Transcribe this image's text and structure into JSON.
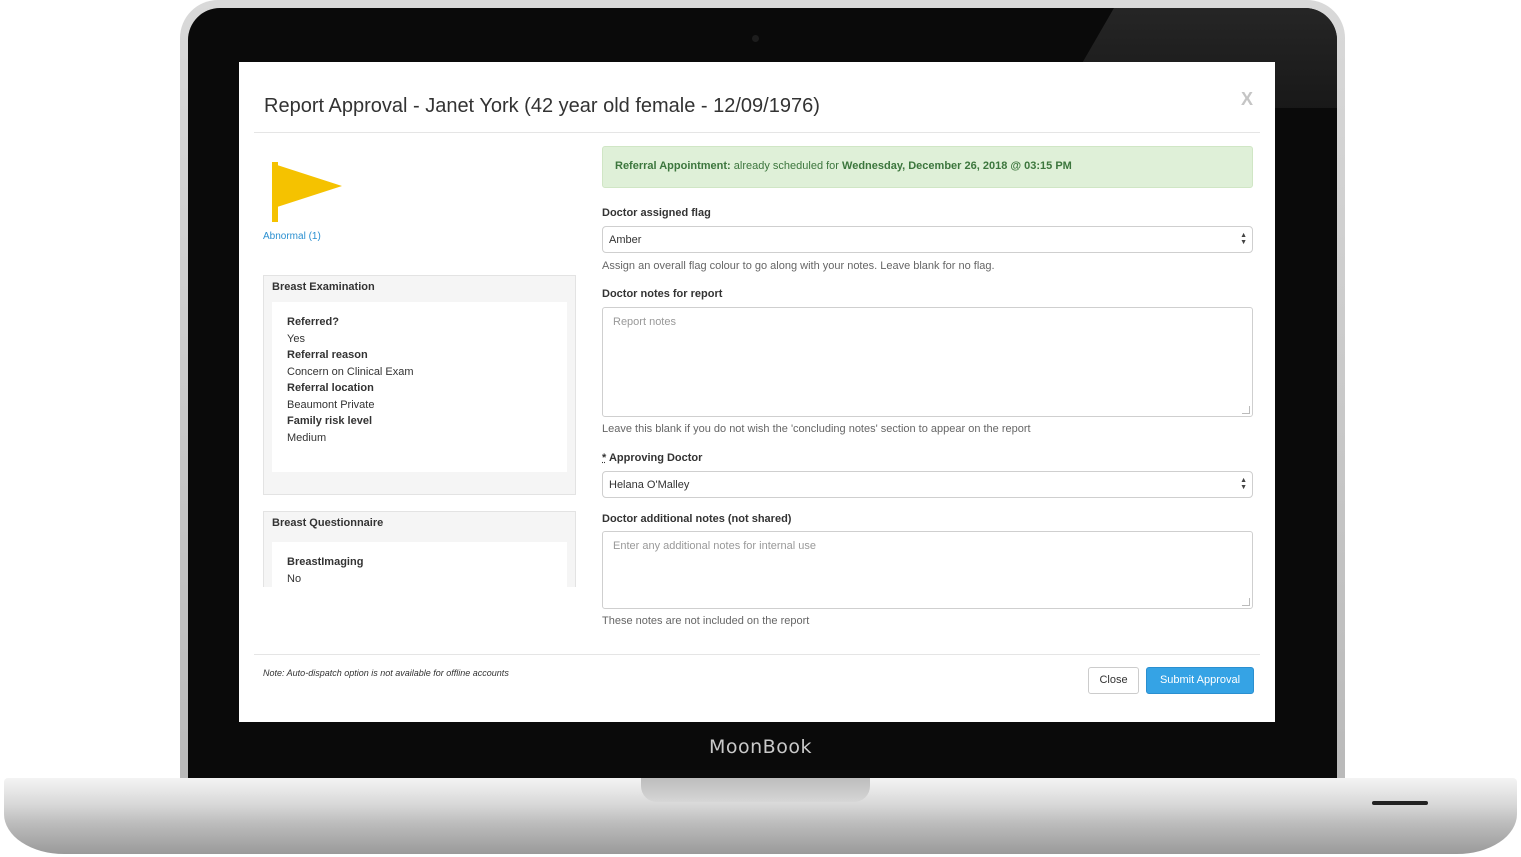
{
  "device": {
    "brand": "MoonBook"
  },
  "modal": {
    "title": "Report Approval - Janet York (42 year old female - 12/09/1976)",
    "close_symbol": "X"
  },
  "flag": {
    "icon": "flag-icon",
    "color": "#f5c200",
    "link_label": "Abnormal (1)"
  },
  "panels": {
    "breast_examination": {
      "title": "Breast Examination",
      "fields": [
        {
          "label": "Referred?",
          "value": "Yes"
        },
        {
          "label": "Referral reason",
          "value": "Concern on Clinical Exam"
        },
        {
          "label": "Referral location",
          "value": "Beaumont Private"
        },
        {
          "label": "Family risk level",
          "value": "Medium"
        }
      ]
    },
    "breast_questionnaire": {
      "title": "Breast Questionnaire",
      "fields": [
        {
          "label": "BreastImaging",
          "value": "No"
        }
      ]
    }
  },
  "alert": {
    "prefix": "Referral Appointment:",
    "middle": " already scheduled for ",
    "datetime": "Wednesday, December 26, 2018 @ 03:15 PM"
  },
  "form": {
    "flag_label": "Doctor assigned flag",
    "flag_value": "Amber",
    "flag_help": "Assign an overall flag colour to go along with your notes. Leave blank for no flag.",
    "notes_label": "Doctor notes for report",
    "notes_placeholder": "Report notes",
    "notes_help": "Leave this blank if you do not wish the 'concluding notes' section to appear on the report",
    "required_marker": "*",
    "approving_label": "Approving Doctor",
    "approving_value": "Helana O'Malley",
    "additional_label": "Doctor additional notes (not shared)",
    "additional_placeholder": "Enter any additional notes for internal use",
    "additional_help": "These notes are not included on the report"
  },
  "footer": {
    "note": "Note: Auto-dispatch option is not available for offline accounts",
    "close_label": "Close",
    "submit_label": "Submit Approval"
  },
  "colors": {
    "accent": "#35a3e5",
    "alert_bg": "#dff0d8",
    "alert_text": "#3c763d"
  }
}
